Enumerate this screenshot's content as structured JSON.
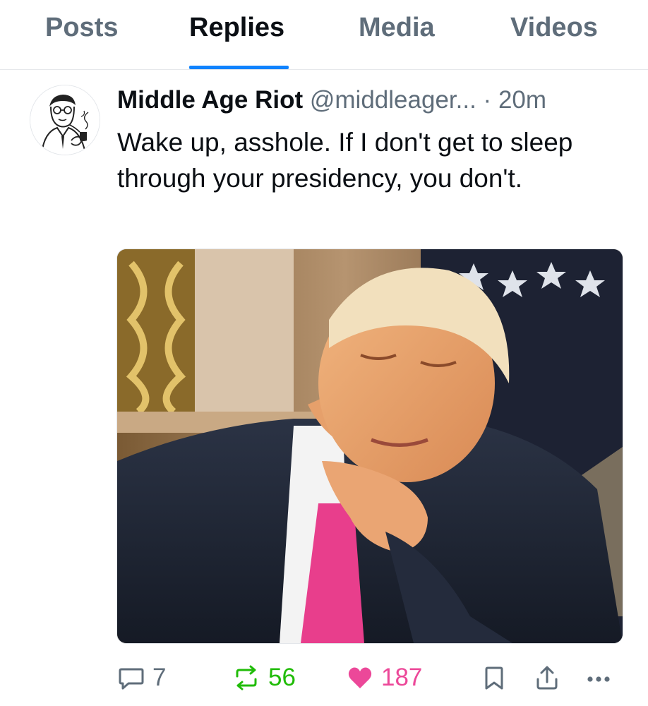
{
  "tabs": [
    {
      "label": "Posts"
    },
    {
      "label": "Replies"
    },
    {
      "label": "Media"
    },
    {
      "label": "Videos"
    }
  ],
  "active_tab": "Replies",
  "post": {
    "display_name": "Middle Age Riot",
    "handle": "@middleager...",
    "separator": "·",
    "time": "20m",
    "text": "Wake up, asshole. If I don't get to sleep through your presidency, you don't.",
    "counts": {
      "replies": "7",
      "reposts": "56",
      "likes": "187"
    }
  },
  "icons": {
    "reply": "speech-bubble-icon",
    "repost": "repost-arrows-icon",
    "like": "heart-icon",
    "bookmark": "bookmark-icon",
    "share": "share-upload-icon",
    "more": "ellipsis-icon"
  },
  "colors": {
    "accent": "#1083fe",
    "muted_text": "#5f6d7a",
    "repost_active": "#20bc07",
    "like_active": "#ec4899",
    "tie_pink": "#e83e8c"
  }
}
